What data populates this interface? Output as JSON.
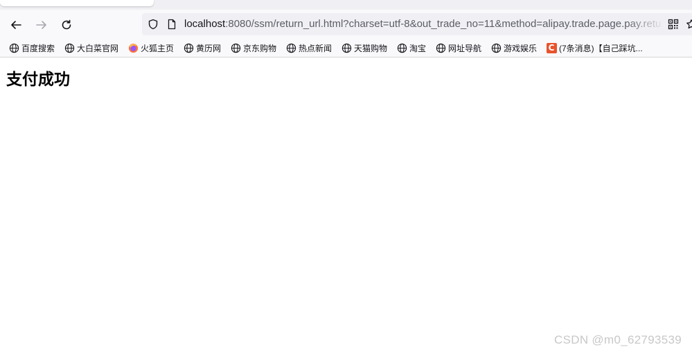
{
  "browser": {
    "url": {
      "host": "localhost",
      "rest": ":8080/ssm/return_url.html?charset=utf-8&out_trade_no=11&method=alipay.trade.page.pay.retu"
    },
    "bookmarks": [
      {
        "label": "百度搜索",
        "icon": "globe-icon"
      },
      {
        "label": "大白菜官网",
        "icon": "globe-icon"
      },
      {
        "label": "火狐主页",
        "icon": "firefox-icon"
      },
      {
        "label": "黄历网",
        "icon": "globe-icon"
      },
      {
        "label": "京东购物",
        "icon": "globe-icon"
      },
      {
        "label": "热点新闻",
        "icon": "globe-icon"
      },
      {
        "label": "天猫购物",
        "icon": "globe-icon"
      },
      {
        "label": "淘宝",
        "icon": "globe-icon"
      },
      {
        "label": "网址导航",
        "icon": "globe-icon"
      },
      {
        "label": "游戏娱乐",
        "icon": "globe-icon"
      },
      {
        "label": "(7条消息)【自己踩坑...",
        "icon": "csdn-icon",
        "icon_letter": "C"
      }
    ]
  },
  "page": {
    "heading": "支付成功"
  },
  "watermark": "CSDN @m0_62793539",
  "colors": {
    "toolbar_bg": "#f9f9fb",
    "urlbar_bg": "#f0f0f4",
    "csdn_brand": "#e8532c"
  }
}
